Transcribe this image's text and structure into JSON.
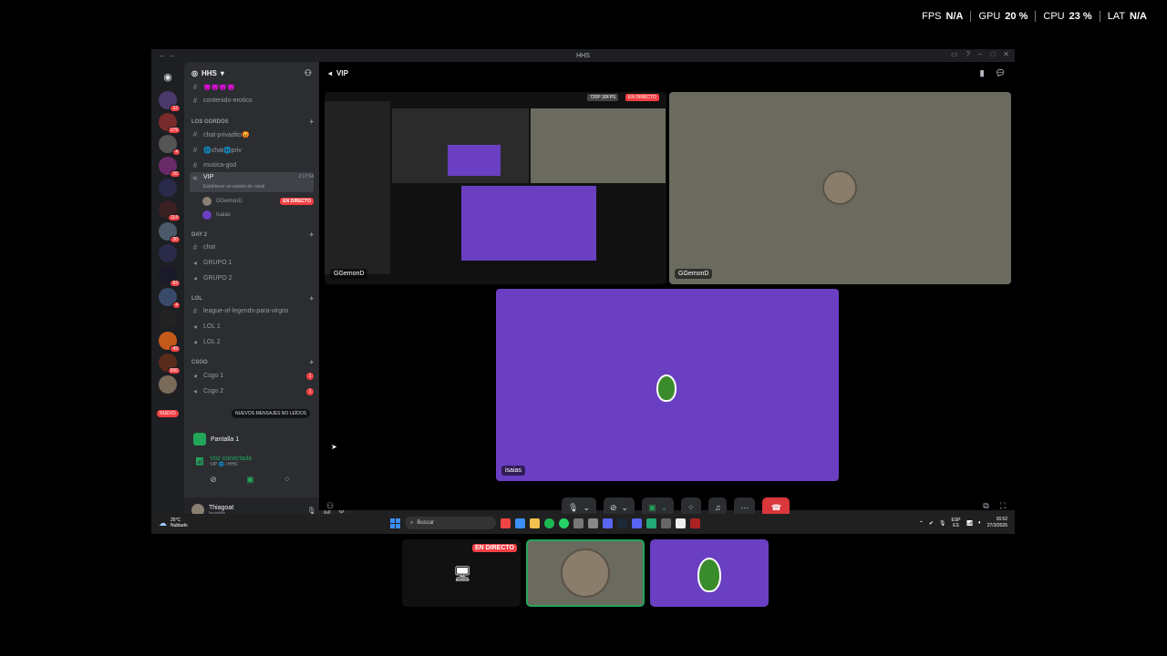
{
  "overlay": {
    "fps_label": "FPS",
    "fps_value": "N/A",
    "gpu_label": "GPU",
    "gpu_value": "20 %",
    "cpu_label": "CPU",
    "cpu_value": "23 %",
    "lat_label": "LAT",
    "lat_value": "N/A"
  },
  "window": {
    "title": "HHS"
  },
  "rail": {
    "badges": [
      "12",
      "179",
      "4",
      "10",
      "114",
      "30",
      "83",
      "4",
      "49",
      "500"
    ],
    "nuevo": "NUEVO"
  },
  "guild": {
    "name": "HHS"
  },
  "channels": {
    "top_emoji": "😈😈😈😈",
    "contenido": "contenido-erotico",
    "cat_gordos": "LOS GORDOS",
    "chat_privadito": "chat-privadito😡",
    "chat_priv": "🌐chat🌐priv",
    "musica": "musica-god",
    "vip_name": "VIP",
    "vip_time": "2:17:54",
    "vip_sub": "Establecer un estado de canal",
    "member1": "GGemonD",
    "member1_live": "EN DIRECTO",
    "member2": "Isaias",
    "cat_day": "DAY 2",
    "chat": "chat",
    "grupo1": "GRUPO 1",
    "grupo2": "GRUPO 2",
    "cat_lol": "LOL",
    "league": "league-of-legends-para-virgos",
    "lol1": "LOL 1",
    "lol2": "LOL 2",
    "cat_csgo": "CSGO",
    "csgo1": "Csgo 1",
    "csgo1_badge": "1",
    "csgo2": "Csgo 2",
    "csgo2_badge": "1",
    "tooltip": "NUEVOS MENSAJES NO LEÍDOS"
  },
  "screen_panel": {
    "label": "Pantalla 1"
  },
  "voice": {
    "status": "Voz conectada",
    "sub": "VIP 🌐 / HHS"
  },
  "user": {
    "name": "Thiagoat",
    "status": "Invisible"
  },
  "stage": {
    "channel": "VIP",
    "tile1_label": "GGemonD",
    "tile1_tag1": "720P 30FPS",
    "tile1_tag2": "EN DIRECTO",
    "tile2_label": "GGemonD",
    "tile3_label": "isaias"
  },
  "taskbar": {
    "temp": "25°C",
    "weather": "Nublado",
    "search": "Buscar",
    "lang1": "ESP",
    "lang2": "ES",
    "time": "16:52",
    "date": "27/3/2026"
  },
  "strip": {
    "live": "EN DIRECTO"
  },
  "colors": {
    "accent_green": "#23a55a",
    "live_red": "#f23f43",
    "isaias_bg": "#6a3fc2",
    "cam_bg": "#6b6a5f"
  }
}
